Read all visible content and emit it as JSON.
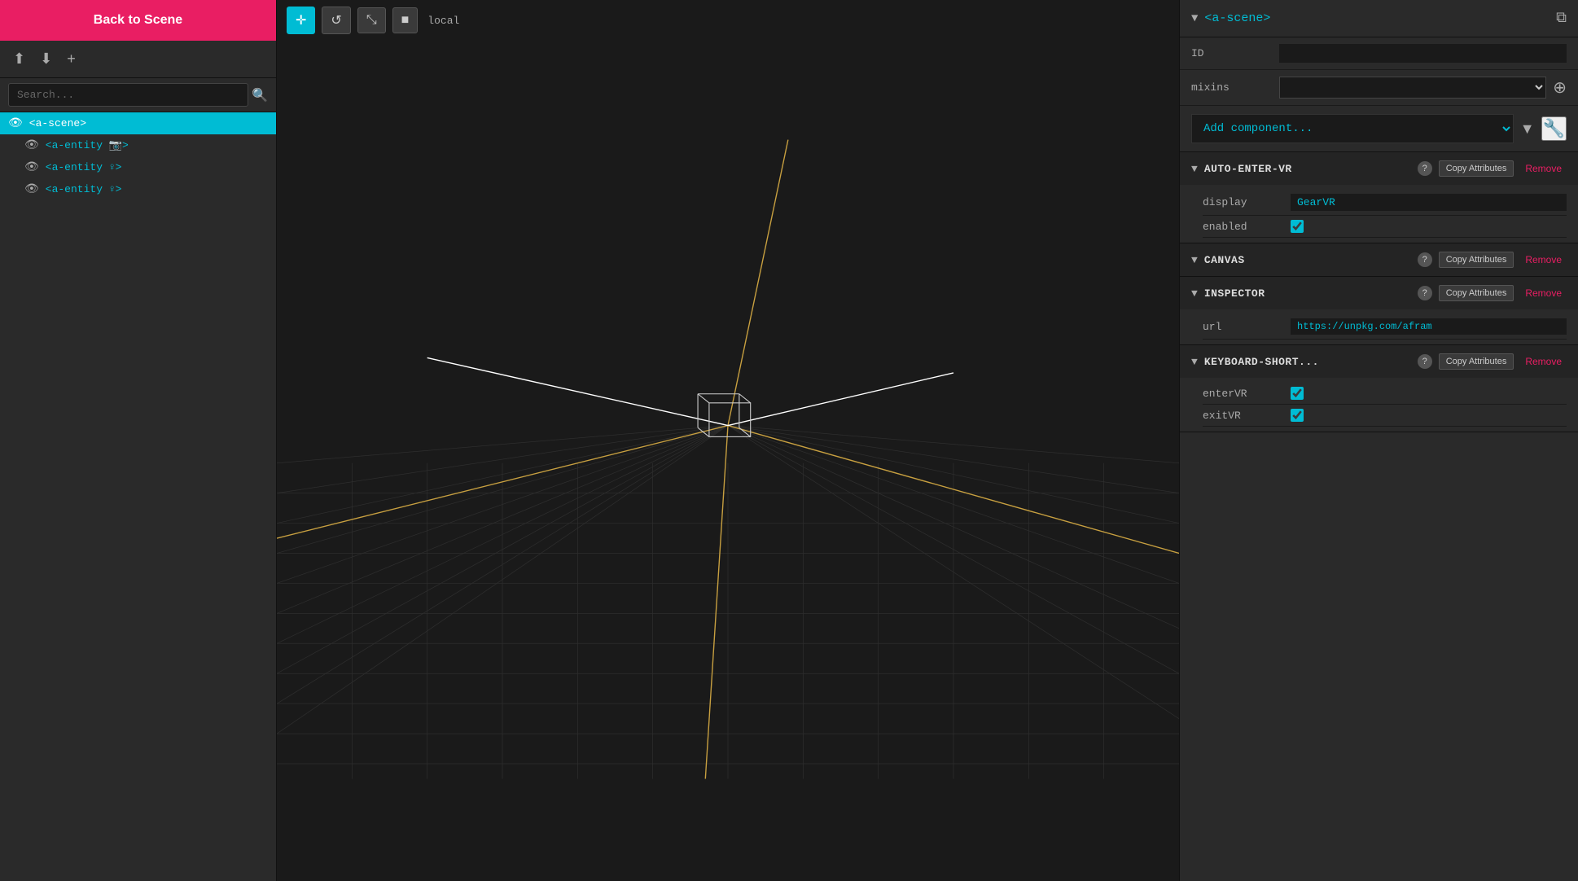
{
  "sidebar": {
    "back_label": "Back to Scene",
    "toolbar": {
      "export_icon": "📤",
      "save_icon": "💾",
      "add_icon": "+"
    },
    "search": {
      "placeholder": "Search..."
    },
    "tree": [
      {
        "id": "a-scene",
        "label": "<a-scene>",
        "level": 0,
        "selected": true,
        "visible": true
      },
      {
        "id": "a-entity-camera",
        "label": "<a-entity 📷>",
        "level": 1,
        "selected": false,
        "visible": true
      },
      {
        "id": "a-entity-vr1",
        "label": "<a-entity ♀>",
        "level": 1,
        "selected": false,
        "visible": true
      },
      {
        "id": "a-entity-vr2",
        "label": "<a-entity ♀>",
        "level": 1,
        "selected": false,
        "visible": true
      }
    ]
  },
  "viewport": {
    "tools": [
      {
        "id": "move",
        "icon": "✛",
        "active": true
      },
      {
        "id": "rotate",
        "icon": "↺",
        "active": false
      },
      {
        "id": "scale",
        "icon": "⤡",
        "active": false
      }
    ],
    "square_icon": "■",
    "mode_label": "local"
  },
  "right_panel": {
    "title": "<a-scene>",
    "copy_icon": "⧉",
    "id_label": "ID",
    "id_value": "",
    "mixins_label": "mixins",
    "add_component_placeholder": "Add component...",
    "components": [
      {
        "id": "auto-enter-vr",
        "name": "AUTO-ENTER-VR",
        "copy_label": "Copy Attributes",
        "remove_label": "Remove",
        "help": "?",
        "props": [
          {
            "label": "display",
            "value": "GearVR",
            "type": "text"
          },
          {
            "label": "enabled",
            "value": true,
            "type": "checkbox"
          }
        ]
      },
      {
        "id": "canvas",
        "name": "CANVAS",
        "copy_label": "Copy Attributes",
        "remove_label": "Remove",
        "help": "?",
        "props": []
      },
      {
        "id": "inspector",
        "name": "INSPECTOR",
        "copy_label": "Copy Attributes",
        "remove_label": "Remove",
        "help": "?",
        "props": [
          {
            "label": "url",
            "value": "https://unpkg.com/afram",
            "type": "link"
          }
        ]
      },
      {
        "id": "keyboard-short",
        "name": "KEYBOARD-SHORT...",
        "copy_label": "Copy Attributes",
        "remove_label": "Remove",
        "help": "?",
        "props": [
          {
            "label": "enterVR",
            "value": true,
            "type": "checkbox"
          },
          {
            "label": "exitVR",
            "value": true,
            "type": "checkbox"
          }
        ]
      }
    ]
  }
}
